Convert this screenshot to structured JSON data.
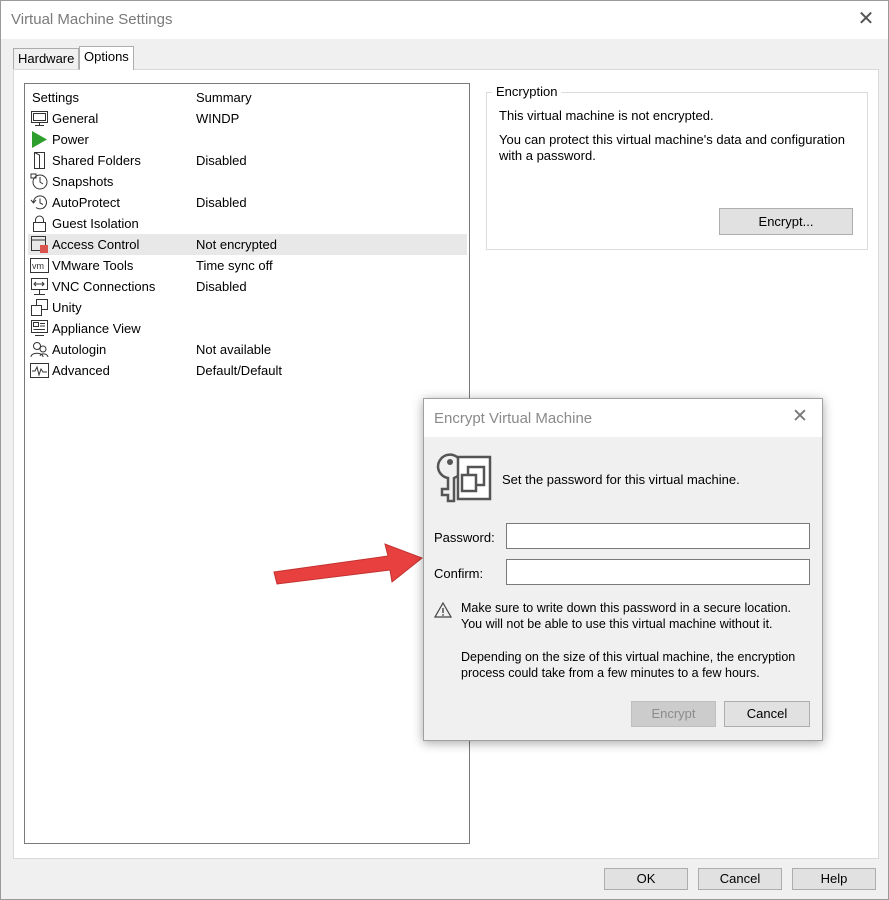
{
  "window": {
    "title": "Virtual Machine Settings",
    "close_glyph": "✕"
  },
  "tabs": [
    {
      "label": "Hardware",
      "active": false
    },
    {
      "label": "Options",
      "active": true
    }
  ],
  "settings_list": {
    "header_settings": "Settings",
    "header_summary": "Summary",
    "selected": "Access Control",
    "items": [
      {
        "name": "General",
        "summary": "WINDP",
        "icon": "monitor-icon"
      },
      {
        "name": "Power",
        "summary": "",
        "icon": "play-icon"
      },
      {
        "name": "Shared Folders",
        "summary": "Disabled",
        "icon": "shared-folder-icon"
      },
      {
        "name": "Snapshots",
        "summary": "",
        "icon": "clock-icon"
      },
      {
        "name": "AutoProtect",
        "summary": "Disabled",
        "icon": "history-icon"
      },
      {
        "name": "Guest Isolation",
        "summary": "",
        "icon": "lock-icon"
      },
      {
        "name": "Access Control",
        "summary": "Not encrypted",
        "icon": "access-control-icon"
      },
      {
        "name": "VMware Tools",
        "summary": "Time sync off",
        "icon": "vm-icon"
      },
      {
        "name": "VNC Connections",
        "summary": "Disabled",
        "icon": "network-icon"
      },
      {
        "name": "Unity",
        "summary": "",
        "icon": "unity-icon"
      },
      {
        "name": "Appliance View",
        "summary": "",
        "icon": "appliance-icon"
      },
      {
        "name": "Autologin",
        "summary": "Not available",
        "icon": "users-icon"
      },
      {
        "name": "Advanced",
        "summary": "Default/Default",
        "icon": "pulse-icon"
      }
    ]
  },
  "encryption": {
    "group_label": "Encryption",
    "status": "This virtual machine is not encrypted.",
    "info_line1": "You can protect this virtual machine's data and configuration",
    "info_line2": "with a password.",
    "encrypt_button": "Encrypt..."
  },
  "footer": {
    "ok": "OK",
    "cancel": "Cancel",
    "help": "Help"
  },
  "dialog": {
    "title": "Encrypt Virtual Machine",
    "close_glyph": "✕",
    "intro": "Set the password for this virtual machine.",
    "password_label": "Password:",
    "password_value": "",
    "confirm_label": "Confirm:",
    "confirm_value": "",
    "warning_line1": "Make sure to write down this password in a secure location.",
    "warning_line2": "You will not be able to use this virtual machine without it.",
    "note_line1": "Depending on the size of this virtual machine, the encryption",
    "note_line2": "process could take from a few minutes to a few hours.",
    "encrypt_button": "Encrypt",
    "encrypt_disabled": true,
    "cancel_button": "Cancel"
  },
  "colors": {
    "arrow": "#e8403e",
    "power_green": "#2e9e2e",
    "selected_row": "#e8e8e8"
  }
}
